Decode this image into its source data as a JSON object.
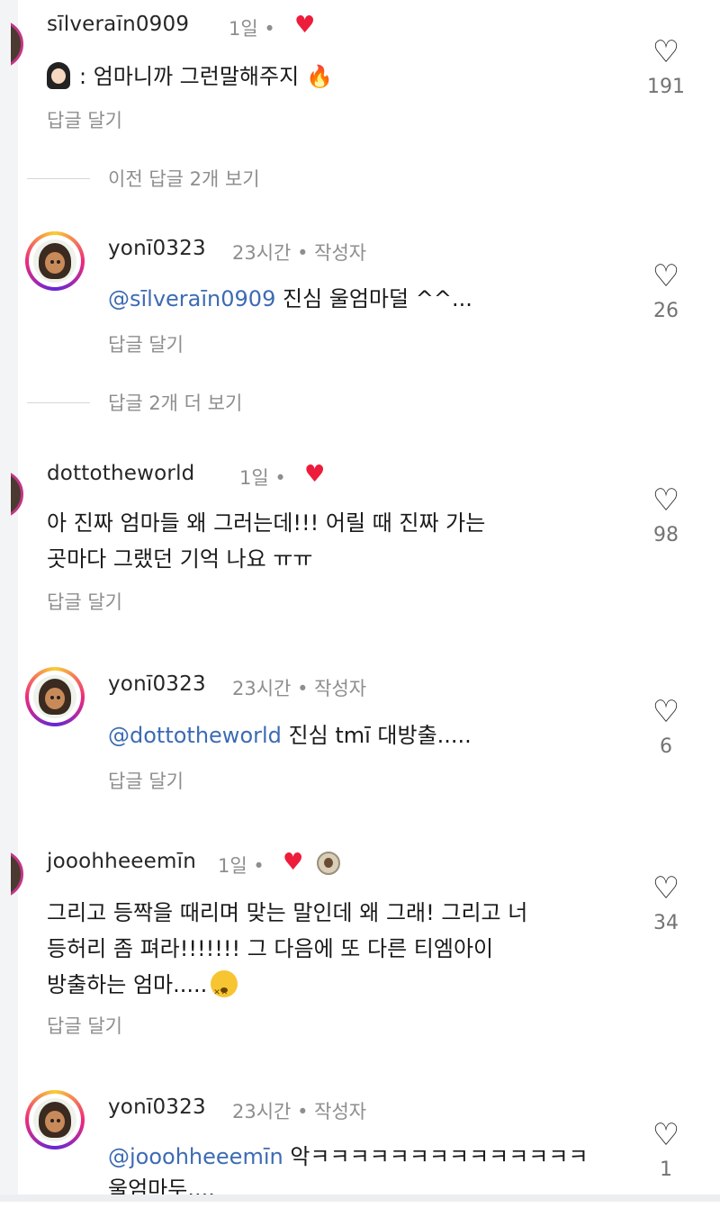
{
  "comments": [
    {
      "username": "sīlveraīn0909",
      "time": "1일",
      "text_parts": [
        "엄마니까 그런말해주지",
        "🔥"
      ],
      "reply_label": "답글 달기",
      "likes": "191"
    },
    {
      "view_more": "이전 답글 2개 보기"
    },
    {
      "username": "yonī0323",
      "time": "23시간",
      "author_tag": "작성자",
      "mention": "@sīlveraīn0909",
      "text": "진심 울엄마덜 ^^...",
      "reply_label": "답글 달기",
      "likes": "26"
    },
    {
      "view_more": "답글 2개 더 보기"
    },
    {
      "username": "dottotheworld",
      "time": "1일",
      "lines": [
        "아 진짜 엄마들 왜 그러는데!!! 어릴 때 진짜 가는",
        "곳마다 그랬던 기억 나요 ㅠㅠ"
      ],
      "reply_label": "답글 달기",
      "likes": "98"
    },
    {
      "username": "yonī0323",
      "time": "23시간",
      "author_tag": "작성자",
      "mention": "@dottotheworld",
      "text": "진심 tmī 대방출.....",
      "reply_label": "답글 달기",
      "likes": "6"
    },
    {
      "username": "jooohheeemīn",
      "time": "1일",
      "lines": [
        "그리고 등짝을 때리며 맞는 말인데 왜 그래! 그리고 너",
        "등허리 좀 펴라!!!!!!! 그 다음에 또 다른 티엠아이",
        "방출하는 엄마....."
      ],
      "reply_label": "답글 달기",
      "likes": "34"
    },
    {
      "username": "yonī0323",
      "time": "23시간",
      "author_tag": "작성자",
      "mention": "@jooohheeemīn",
      "text": "악ㅋㅋㅋㅋㅋㅋㅋㅋㅋㅋㅋㅋㅋㅋ",
      "line2": "울엄마두....",
      "likes": "1"
    }
  ],
  "icons": {
    "like": "heart-outline-icon",
    "liked_by_author": "heart-filled-icon",
    "colors": {
      "heart": "#ed1c3a",
      "mention": "#3d6bb3",
      "muted": "#8e8e8e"
    }
  },
  "separator_dot": "•"
}
